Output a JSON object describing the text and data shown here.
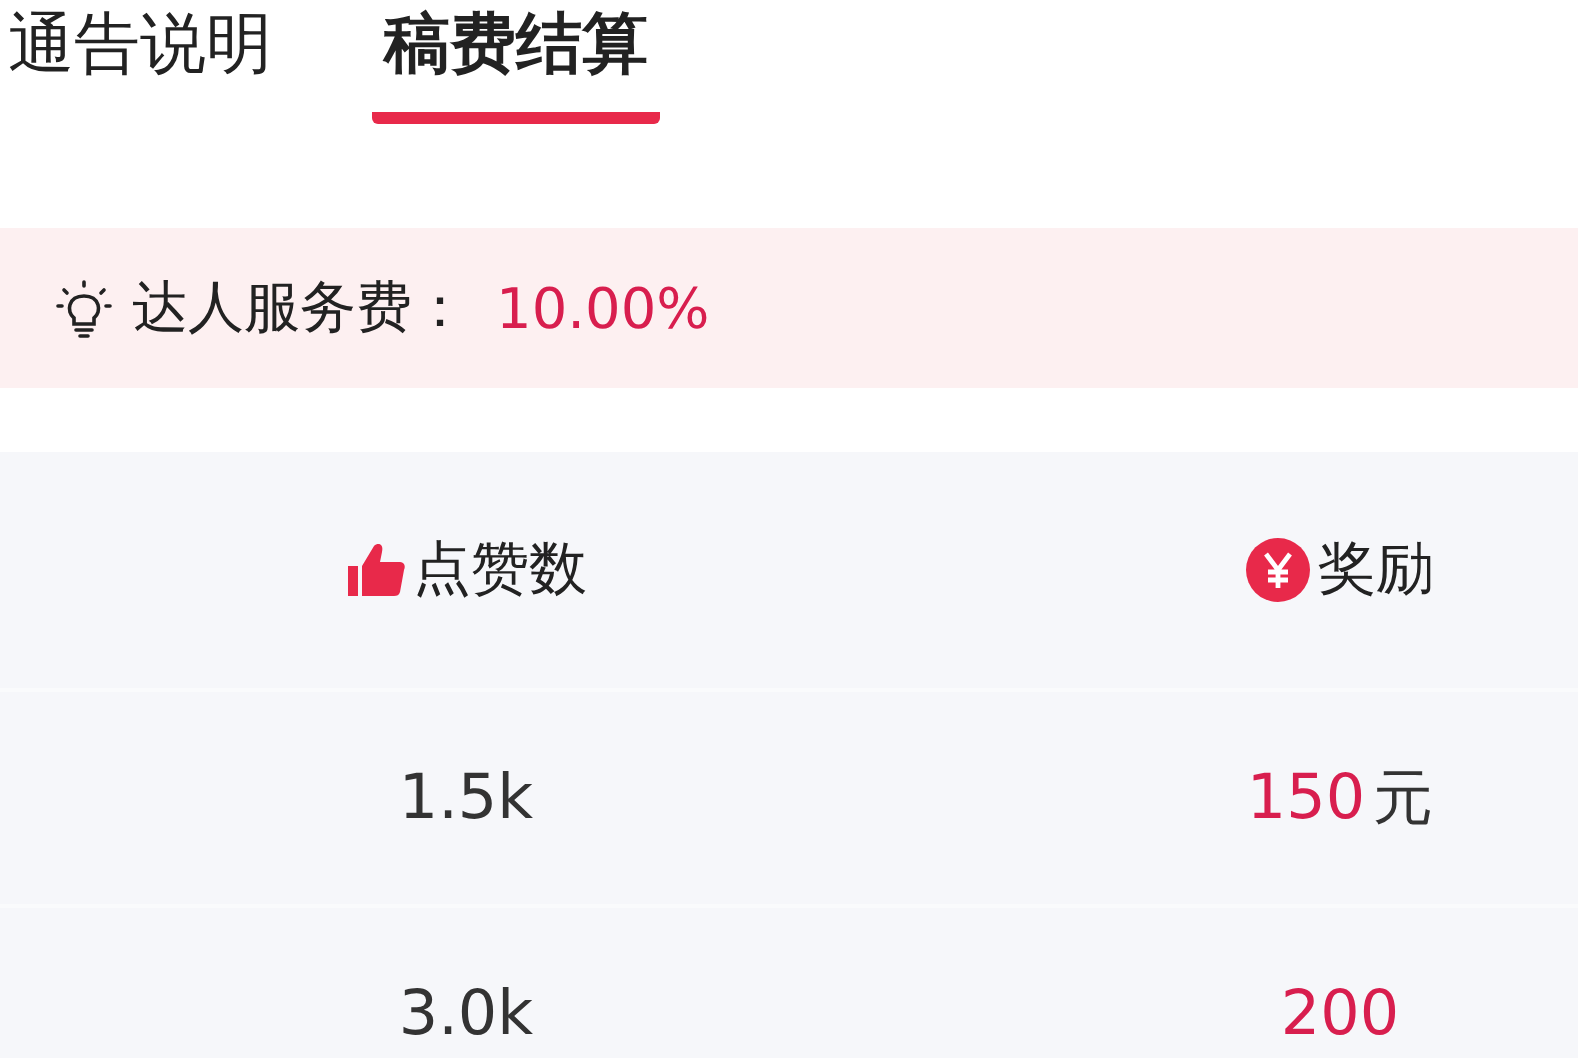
{
  "tabs": [
    {
      "label": "通告说明",
      "selected": false
    },
    {
      "label": "稿费结算",
      "selected": true
    }
  ],
  "notice": {
    "label": "达人服务费：",
    "value": "10.00%"
  },
  "table": {
    "columns": [
      {
        "label": "点赞数",
        "kind": "likes"
      },
      {
        "label": "奖励",
        "kind": "reward"
      }
    ],
    "rows": [
      {
        "likes": "1.5k",
        "amount": "150",
        "unit": "元"
      },
      {
        "likes": "3.0k",
        "amount": "200"
      }
    ]
  }
}
